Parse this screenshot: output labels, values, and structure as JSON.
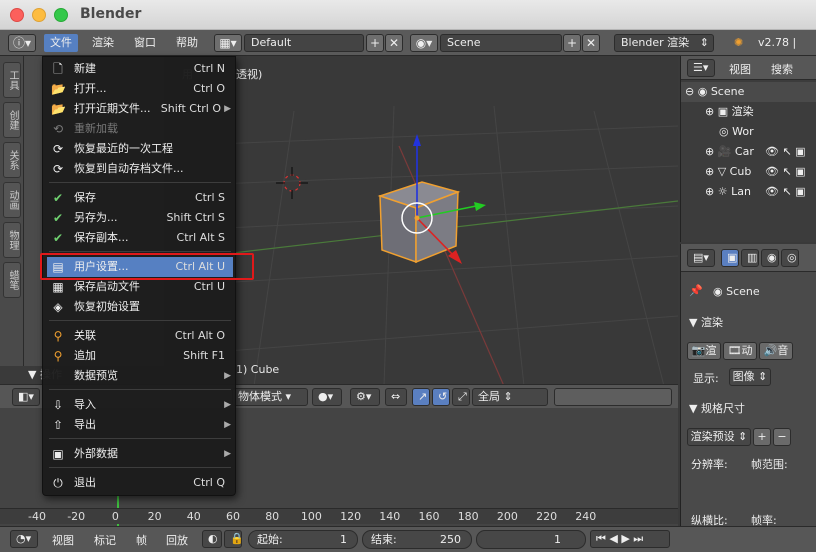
{
  "window": {
    "title": "Blender"
  },
  "header": {
    "menus": [
      "文件",
      "渲染",
      "窗口",
      "帮助"
    ],
    "layout": "Default",
    "scene": "Scene",
    "engine": "Blender 渲染",
    "version": "v2.78 | Ver"
  },
  "left_tabs": [
    "工具",
    "创建",
    "关系",
    "动画",
    "物理",
    "蜡笔"
  ],
  "shelf": {
    "operator_label": "操作"
  },
  "viewport": {
    "view_label_fragment": "用",
    "persp_fragment": "透视)",
    "object_label_fragment": "1) Cube"
  },
  "file_menu": {
    "items": [
      {
        "icon": "new-file-icon",
        "label": "新建",
        "shortcut": "Ctrl N",
        "submenu": false,
        "dim": false
      },
      {
        "icon": "open-folder-icon",
        "label": "打开...",
        "shortcut": "Ctrl O",
        "submenu": false,
        "dim": false
      },
      {
        "icon": "open-recent-icon",
        "label": "打开近期文件...",
        "shortcut": "Shift Ctrl O",
        "submenu": true,
        "dim": false
      },
      {
        "icon": "revert-icon",
        "label": "重新加载",
        "shortcut": "",
        "submenu": false,
        "dim": true
      },
      {
        "icon": "recover-last-icon",
        "label": "恢复最近的一次工程",
        "shortcut": "",
        "submenu": false,
        "dim": false
      },
      {
        "icon": "recover-auto-icon",
        "label": "恢复到自动存档文件...",
        "shortcut": "",
        "submenu": false,
        "dim": false
      },
      {
        "icon": "save-check-icon",
        "label": "保存",
        "shortcut": "Ctrl S",
        "submenu": false,
        "dim": false
      },
      {
        "icon": "save-as-check-icon",
        "label": "另存为...",
        "shortcut": "Shift Ctrl S",
        "submenu": false,
        "dim": false
      },
      {
        "icon": "save-copy-check-icon",
        "label": "保存副本...",
        "shortcut": "Ctrl Alt S",
        "submenu": false,
        "dim": false
      },
      {
        "icon": "user-prefs-icon",
        "label": "用户设置...",
        "shortcut": "Ctrl Alt U",
        "submenu": false,
        "dim": false
      },
      {
        "icon": "save-startup-icon",
        "label": "保存启动文件",
        "shortcut": "Ctrl U",
        "submenu": false,
        "dim": false
      },
      {
        "icon": "load-factory-icon",
        "label": "恢复初始设置",
        "shortcut": "",
        "submenu": false,
        "dim": false
      },
      {
        "icon": "link-icon",
        "label": "关联",
        "shortcut": "Ctrl Alt O",
        "submenu": false,
        "dim": false
      },
      {
        "icon": "append-icon",
        "label": "追加",
        "shortcut": "Shift F1",
        "submenu": false,
        "dim": false
      },
      {
        "icon": "",
        "label": "数据预览",
        "shortcut": "",
        "submenu": true,
        "dim": false
      },
      {
        "icon": "import-icon",
        "label": "导入",
        "shortcut": "",
        "submenu": true,
        "dim": false
      },
      {
        "icon": "export-icon",
        "label": "导出",
        "shortcut": "",
        "submenu": true,
        "dim": false
      },
      {
        "icon": "external-data-icon",
        "label": "外部数据",
        "shortcut": "",
        "submenu": true,
        "dim": false
      },
      {
        "icon": "power-icon",
        "label": "退出",
        "shortcut": "Ctrl Q",
        "submenu": false,
        "dim": false
      }
    ],
    "highlighted_index": 9
  },
  "viewport_header": {
    "mode": "物体模式",
    "pivot_fragment": "全局"
  },
  "timeline": {
    "ticks": [
      "-40",
      "-20",
      "0",
      "20",
      "40",
      "60",
      "80",
      "100",
      "120",
      "140",
      "160",
      "180",
      "200",
      "220",
      "240"
    ]
  },
  "bottom_bar": {
    "menus": [
      "视图",
      "标记",
      "帧",
      "回放"
    ],
    "start_label": "起始:",
    "start_value": "1",
    "end_label": "结束:",
    "end_value": "250",
    "current_frame": "1"
  },
  "outliner": {
    "tabs": [
      "视图",
      "搜索"
    ],
    "rows": [
      "Scene",
      "渲染",
      "Wor",
      "Car",
      "Cub",
      "Lan"
    ]
  },
  "properties": {
    "scene": "Scene",
    "render_panel": "渲染",
    "render_buttons": [
      "渲",
      "动",
      "音"
    ],
    "display_label": "显示:",
    "display_value": "图像",
    "dimensions_panel": "规格尺寸",
    "preset": "渲染预设",
    "resolution_label": "分辨率:",
    "frame_range_label": "帧范围:",
    "aspect_label": "纵横比:",
    "frame_rate_label": "帧率:"
  },
  "colors": {
    "menu_highlight": "#5680c2",
    "callout_border": "#e0191a",
    "axis_x": "#d33",
    "axis_y": "#3c3",
    "axis_z": "#33d"
  }
}
